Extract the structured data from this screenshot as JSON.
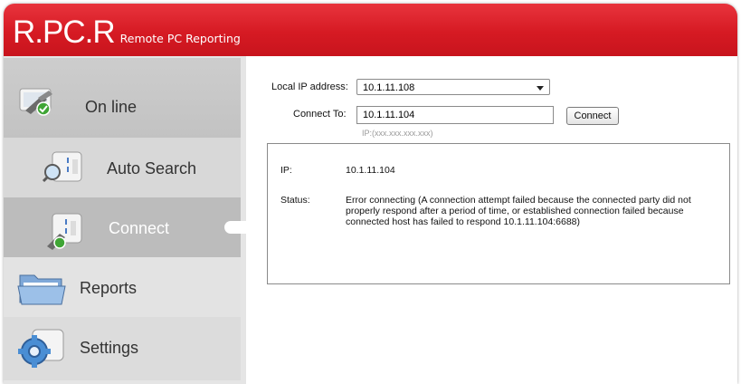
{
  "app": {
    "logo_main": "R.PC.R",
    "logo_sub": "Remote PC Reporting"
  },
  "sidebar": {
    "items": [
      {
        "label": "On line",
        "icon": "online-pc-icon"
      },
      {
        "label": "Auto Search",
        "icon": "search-pc-icon"
      },
      {
        "label": "Connect",
        "icon": "connect-pc-icon"
      },
      {
        "label": "Reports",
        "icon": "folder-icon"
      },
      {
        "label": "Settings",
        "icon": "gear-icon"
      }
    ]
  },
  "form": {
    "local_ip_label": "Local IP address:",
    "local_ip_value": "10.1.11.108",
    "connect_to_label": "Connect To:",
    "connect_to_value": "10.1.11.104",
    "connect_button": "Connect",
    "ip_hint": "IP:(xxx.xxx.xxx.xxx)"
  },
  "status": {
    "ip_label": "IP:",
    "ip_value": "10.1.11.104",
    "status_label": "Status:",
    "status_value": "Error connecting (A connection attempt failed because the connected party did not properly respond after a period of time, or established connection failed because connected host has failed to respond 10.1.11.104:6688)"
  },
  "colors": {
    "brand_red": "#d61a23",
    "selected_item": "#bcbcbc"
  }
}
